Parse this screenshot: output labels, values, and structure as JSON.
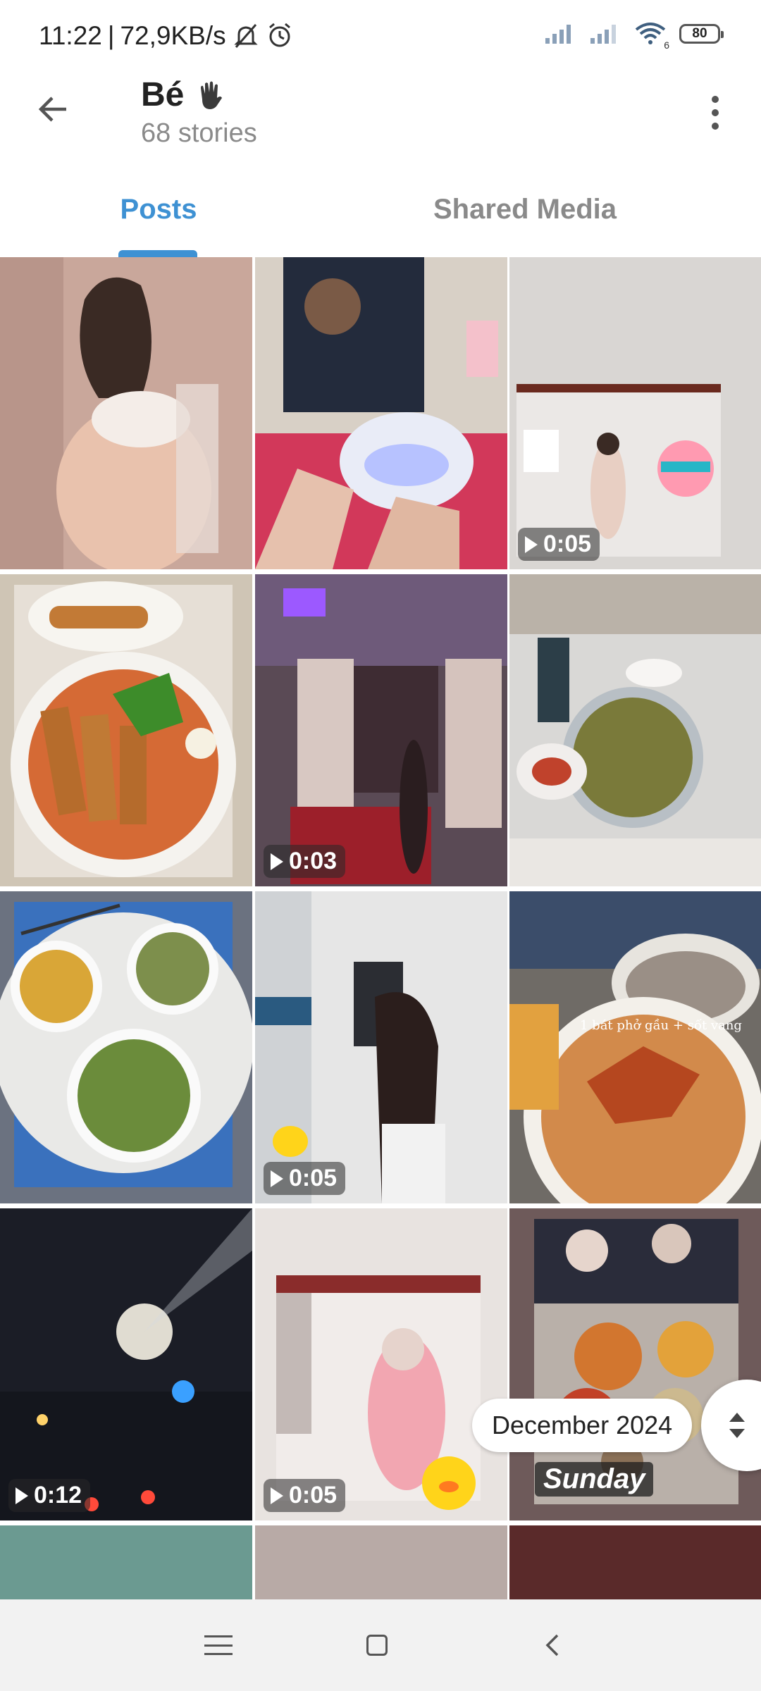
{
  "status_bar": {
    "time": "11:22",
    "separator": "|",
    "net_speed": "72,9KB/s",
    "wifi_sub": "6",
    "battery": "80"
  },
  "header": {
    "title": "Bé",
    "subtitle": "68 stories"
  },
  "tabs": [
    {
      "label": "Posts",
      "active": true
    },
    {
      "label": "Shared Media",
      "active": false
    }
  ],
  "colors": {
    "accent": "#3e91d3"
  },
  "grid": {
    "items": [
      {
        "duration": ""
      },
      {
        "duration": ""
      },
      {
        "duration": "0:05"
      },
      {
        "duration": ""
      },
      {
        "duration": "0:03"
      },
      {
        "duration": ""
      },
      {
        "duration": ""
      },
      {
        "duration": "0:05"
      },
      {
        "duration": ""
      },
      {
        "duration": "0:12"
      },
      {
        "duration": "0:05"
      },
      {
        "duration": ""
      }
    ],
    "overlay_texts": {
      "food_caption": "1 bát phở gầu + sốt vang",
      "sunday_label": "Sunday"
    }
  },
  "date_pill": "December 2024",
  "icons": {
    "back": "arrow-left",
    "more": "vertical-dots",
    "scroll": "up-down-chevrons"
  }
}
